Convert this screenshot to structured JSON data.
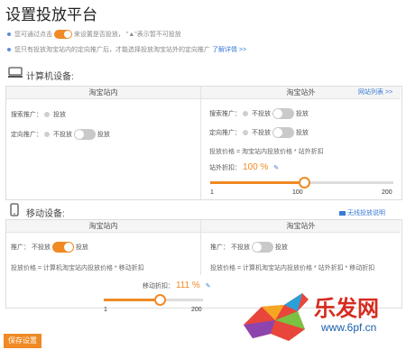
{
  "page": {
    "title": "设置投放平台"
  },
  "tips": {
    "line1_a": "您可通过点击",
    "line1_b": "来设置是否投放，",
    "line1_c": "\"▲\"表示暂不可投放",
    "line2_a": "您只有投放淘宝站内的定向推广后，才能选择投放淘宝站外的定向推广",
    "line2_link": "了解详情 >>"
  },
  "computer": {
    "heading": "计算机设备:",
    "left_col": "淘宝站内",
    "right_col": "淘宝站外",
    "site_list_link": "网站列表 >>",
    "search_label": "搜索推广：",
    "search_status": "投放",
    "directed_label": "定向推广：",
    "directed_status": "不投放",
    "directed_action": "投放",
    "right_search_label": "搜索推广：",
    "right_search_status": "不投放",
    "right_search_action": "投放",
    "right_directed_label": "定向推广：",
    "right_directed_status": "不投放",
    "right_directed_action": "投放",
    "price_formula": "投放价格 = 淘宝站内投放价格 * 站外折扣",
    "discount_label": "站外折扣：",
    "discount_value": "100 %",
    "slider": {
      "min": "1",
      "mid": "100",
      "max": "200",
      "value_fraction": 0.51
    }
  },
  "mobile": {
    "heading": "移动设备:",
    "wireless_link": "无线投放说明",
    "left_col": "淘宝站内",
    "right_col": "淘宝站外",
    "left_label": "推广：",
    "left_status": "不投放",
    "left_action": "投放",
    "right_label": "推广：",
    "right_status": "不投放",
    "right_action": "投放",
    "left_formula": "投放价格 = 计算机淘宝站内投放价格 * 移动折扣",
    "right_formula": "投放价格 = 计算机淘宝站内投放价格 * 站外折扣 * 移动折扣",
    "discount_label": "移动折扣：",
    "discount_value": "111 %",
    "slider": {
      "min": "1",
      "max": "200",
      "value_fraction": 0.56
    }
  },
  "footer": {
    "save_label": "保存设置"
  },
  "watermark": {
    "line1": "乐发网",
    "line2": "www.6pf.cn"
  },
  "colors": {
    "accent": "#f08a24",
    "link": "#3a7bd5",
    "off": "#c9c9c9"
  },
  "icons": [
    "computer-icon",
    "mobile-icon",
    "edit-icon",
    "video-icon",
    "help-icon"
  ]
}
